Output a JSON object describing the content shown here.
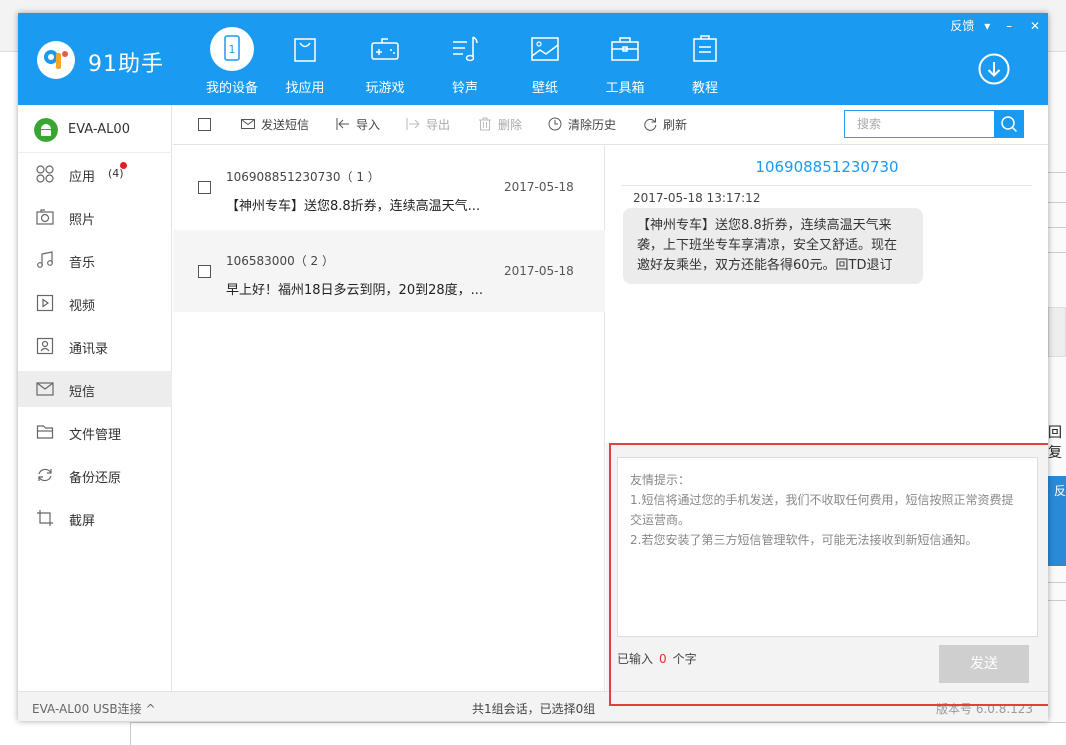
{
  "app": {
    "logo_text": "91助手"
  },
  "nav": [
    {
      "label": "我的设备",
      "icon": "device-icon"
    },
    {
      "label": "找应用",
      "icon": "shopping-bag-icon"
    },
    {
      "label": "玩游戏",
      "icon": "gamepad-icon"
    },
    {
      "label": "铃声",
      "icon": "music-note-icon"
    },
    {
      "label": "壁纸",
      "icon": "wallpaper-icon"
    },
    {
      "label": "工具箱",
      "icon": "toolbox-icon"
    },
    {
      "label": "教程",
      "icon": "clipboard-icon"
    }
  ],
  "window_controls": {
    "feedback": "反馈",
    "menu": "▾",
    "minimize": "–",
    "close": "✕"
  },
  "device": {
    "name": "EVA-AL00"
  },
  "sidebar": [
    {
      "label": "应用",
      "badge": "(4)",
      "icon": "apps-grid-icon"
    },
    {
      "label": "照片",
      "icon": "camera-icon"
    },
    {
      "label": "音乐",
      "icon": "music-icon"
    },
    {
      "label": "视频",
      "icon": "video-icon"
    },
    {
      "label": "通讯录",
      "icon": "contacts-icon"
    },
    {
      "label": "短信",
      "icon": "envelope-icon"
    },
    {
      "label": "文件管理",
      "icon": "folder-icon"
    },
    {
      "label": "备份还原",
      "icon": "refresh-icon"
    },
    {
      "label": "截屏",
      "icon": "crop-icon"
    }
  ],
  "toolbar": {
    "send_sms": "发送短信",
    "import": "导入",
    "export": "导出",
    "delete": "删除",
    "clear_history": "清除历史",
    "refresh": "刷新",
    "search_placeholder": "搜索"
  },
  "messages": [
    {
      "number": "106908851230730（ 1 ）",
      "preview": "【神州专车】送您8.8折券，连续高温天气...",
      "date": "2017-05-18"
    },
    {
      "number": "106583000（ 2 ）",
      "preview": "早上好！福州18日多云到阴，20到28度，...",
      "date": "2017-05-18"
    }
  ],
  "conversation": {
    "title": "106908851230730",
    "time": "2017-05-18 13:17:12",
    "bubble": "【神州专车】送您8.8折券，连续高温天气来袭，上下班坐专车享清凉，安全又舒适。现在邀好友乘坐，双方还能各得60元。回TD退订"
  },
  "compose": {
    "hint_title": "友情提示：",
    "hint_1": "1.短信将通过您的手机发送，我们不收取任何费用，短信按照正常资费提交运营商。",
    "hint_2": "2.若您安装了第三方短信管理软件，可能无法接收到新短信通知。",
    "count_prefix": "已输入",
    "count_value": "0",
    "count_suffix": "个字",
    "send_label": "发送"
  },
  "statusbar": {
    "connection": "EVA-AL00   USB连接 ^",
    "summary": "共1组会话，已选择0组",
    "version": "版本号 6.0.8.123"
  },
  "background": {
    "side_text": "回复",
    "side_blue_text": "反"
  },
  "colors": {
    "brand_blue": "#1a9af0",
    "highlight_red": "#e04040",
    "badge_red": "#e02020"
  }
}
